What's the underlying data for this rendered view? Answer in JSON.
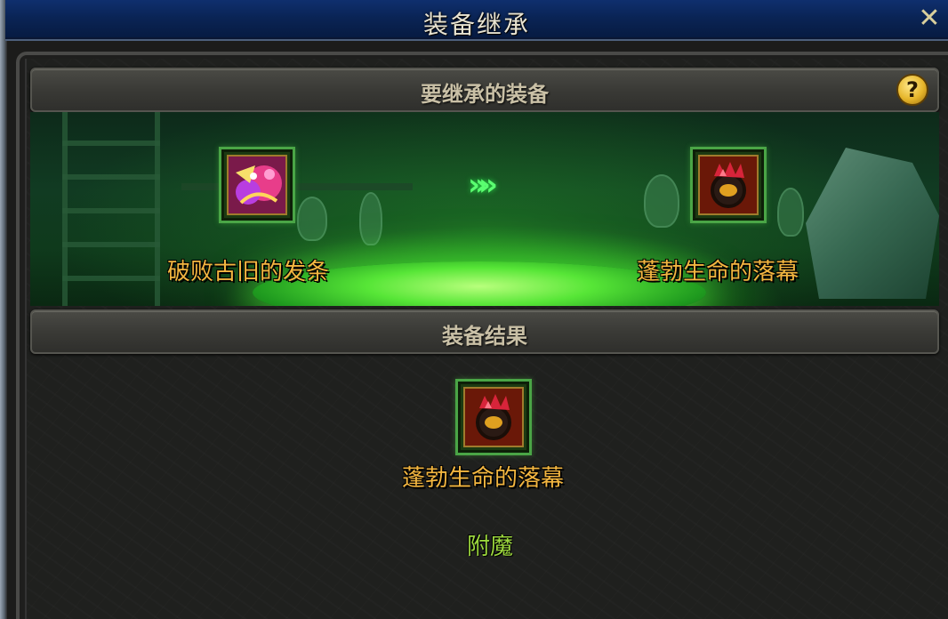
{
  "window": {
    "title": "装备继承",
    "close_label": "✕"
  },
  "sections": {
    "source_title": "要继承的装备",
    "result_title": "装备结果",
    "help_label": "?"
  },
  "inheritance": {
    "from_item": {
      "name": "破败古旧的发条",
      "icon": "hair-ribbon-icon"
    },
    "to_item": {
      "name": "蓬勃生命的落幕",
      "icon": "ring-icon"
    },
    "arrow_label": "»»"
  },
  "result": {
    "item": {
      "name": "蓬勃生命的落幕",
      "icon": "ring-icon"
    },
    "attribute": "附魔"
  },
  "colors": {
    "title_bar": "#0a2455",
    "item_name": "#f3b640",
    "enchant": "#9bd63d",
    "slot_border": "#4aa546",
    "glow": "#57e637"
  }
}
